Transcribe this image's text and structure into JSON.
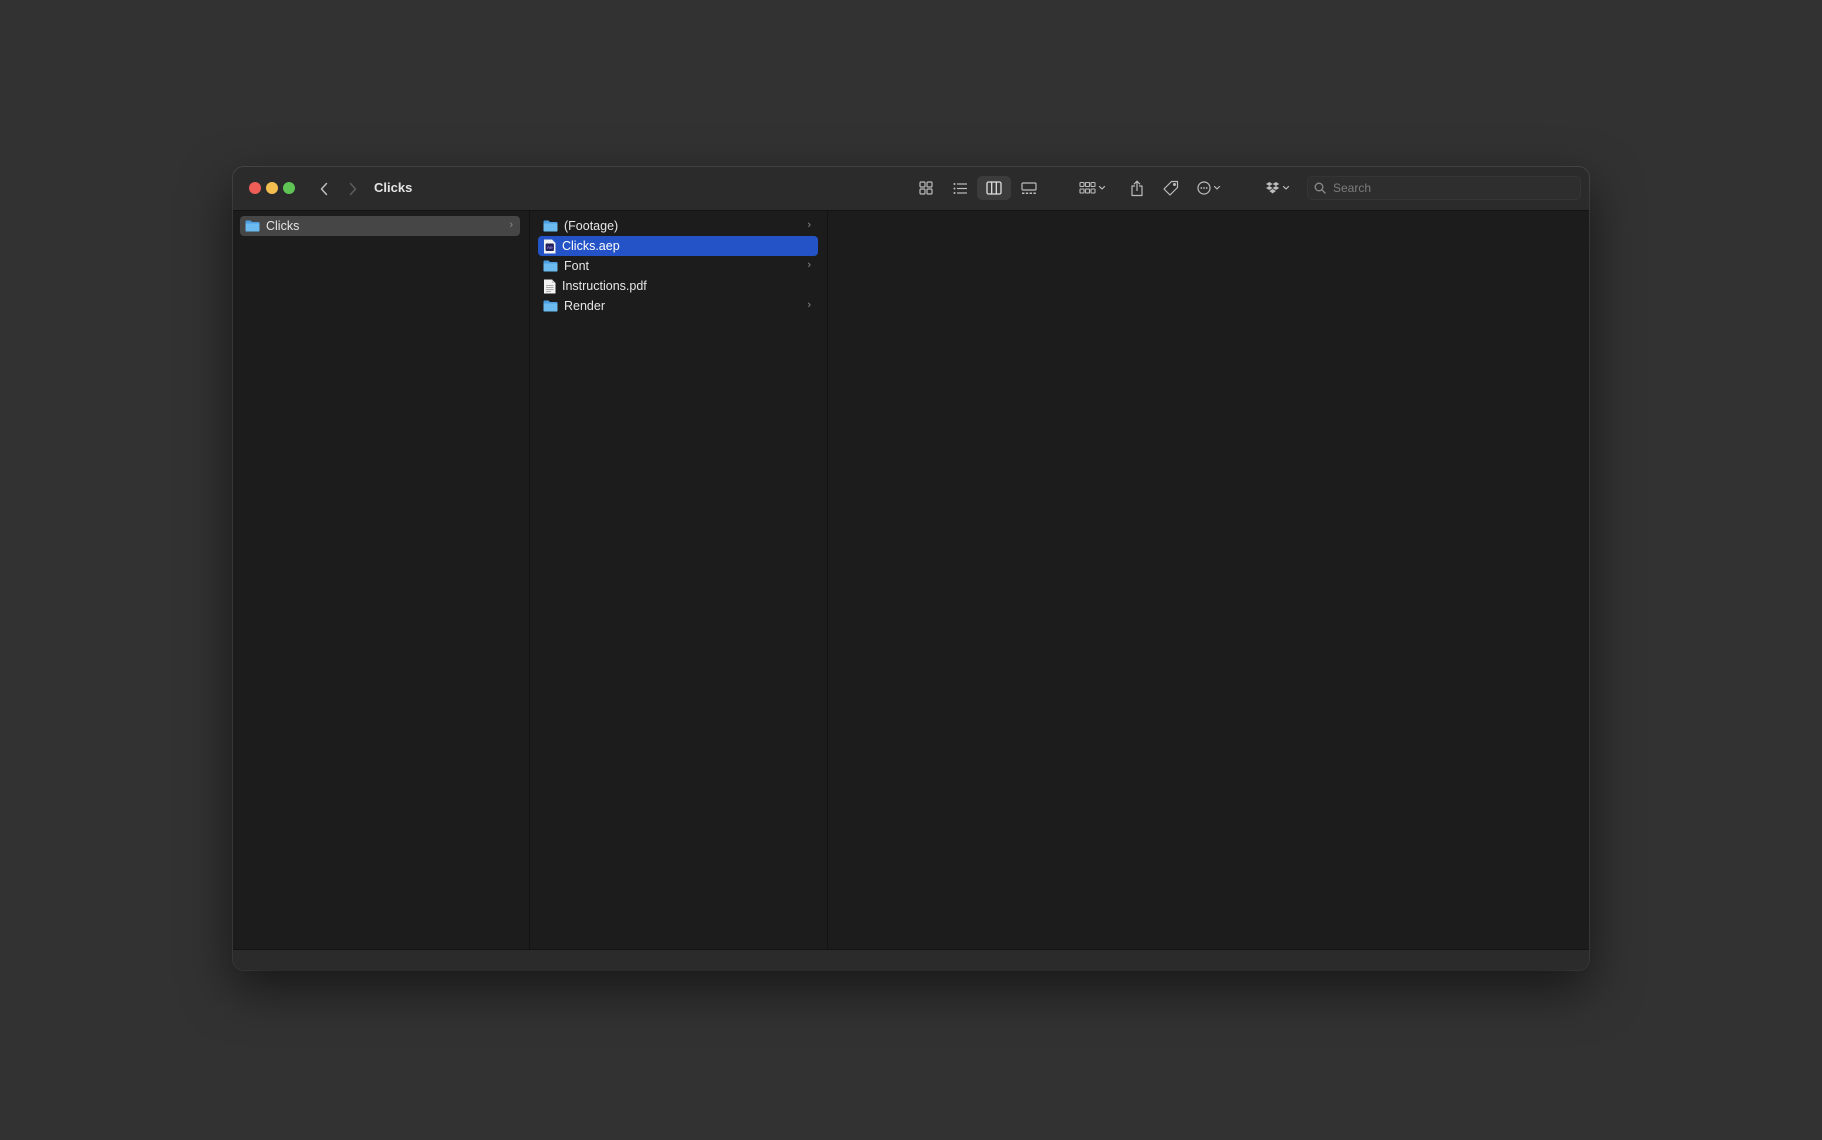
{
  "window": {
    "title": "Clicks",
    "traffic_lights": {
      "close": "#ee5e57",
      "minimize": "#f4bd4f",
      "maximize": "#5fc454"
    }
  },
  "toolbar": {
    "icons": [
      "icon-view-icon",
      "list-view-icon",
      "column-view-icon",
      "gallery-view-icon",
      "group-icon",
      "share-icon",
      "tag-icon",
      "more-actions-icon",
      "dropbox-icon"
    ],
    "active_view": "column-view-icon"
  },
  "search": {
    "placeholder": "Search",
    "value": ""
  },
  "columns": [
    {
      "items": [
        {
          "name": "Clicks",
          "kind": "folder",
          "has_children": true,
          "selected": "inactive"
        }
      ]
    },
    {
      "items": [
        {
          "name": "(Footage)",
          "kind": "folder",
          "has_children": true
        },
        {
          "name": "Clicks.aep",
          "kind": "aep-file",
          "has_children": false,
          "selected": "active"
        },
        {
          "name": "Font",
          "kind": "folder",
          "has_children": true
        },
        {
          "name": "Instructions.pdf",
          "kind": "pdf-file",
          "has_children": false
        },
        {
          "name": "Render",
          "kind": "folder",
          "has_children": true
        }
      ]
    }
  ],
  "colors": {
    "selection_active": "#2353c6",
    "selection_inactive": "#464646",
    "folder": "#5aaee8"
  }
}
